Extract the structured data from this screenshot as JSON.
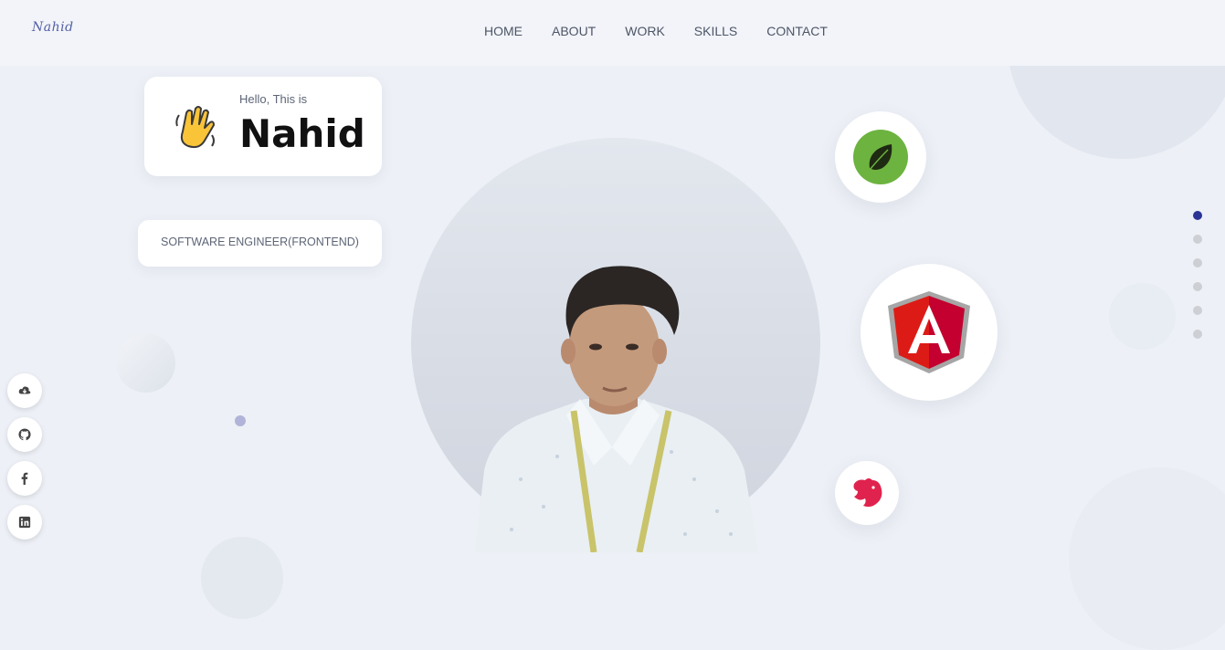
{
  "brand": {
    "logo_text": "Nahid"
  },
  "nav": {
    "items": [
      {
        "label": "HOME"
      },
      {
        "label": "ABOUT"
      },
      {
        "label": "WORK"
      },
      {
        "label": "SKILLS"
      },
      {
        "label": "CONTACT"
      }
    ]
  },
  "hero": {
    "greeting": "Hello, This is",
    "name": "Nahid",
    "role": "SOFTWARE ENGINEER(FRONTEND)",
    "wave_icon": "waving-hand-icon"
  },
  "tech": {
    "icons": [
      "spring-leaf-icon",
      "angular-logo-icon",
      "nestjs-logo-icon"
    ]
  },
  "social": {
    "icons": [
      "download-cloud-icon",
      "github-icon",
      "facebook-icon",
      "linkedin-icon"
    ]
  },
  "section_nav": {
    "count": 6,
    "active_index": 0
  },
  "colors": {
    "background": "#edf0f6",
    "accent": "#2a3496",
    "angular_red": "#dd1b16",
    "spring_green": "#6db33f",
    "nest_red": "#e0234e"
  }
}
